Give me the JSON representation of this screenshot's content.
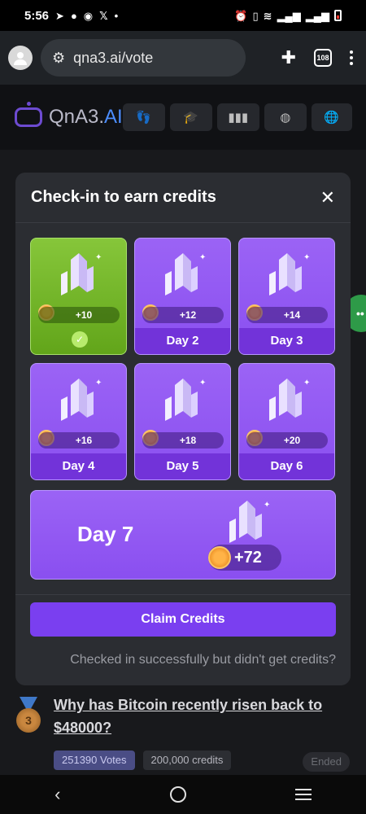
{
  "status": {
    "time": "5:56"
  },
  "browser": {
    "url": "qna3.ai/vote",
    "tab_count": "108"
  },
  "site": {
    "logo_text": "QnA3.",
    "logo_suffix": "AI"
  },
  "modal": {
    "title": "Check-in to earn credits",
    "cards": [
      {
        "amount": "+10",
        "day": "",
        "state": "done"
      },
      {
        "amount": "+12",
        "day": "Day 2",
        "state": "pending"
      },
      {
        "amount": "+14",
        "day": "Day 3",
        "state": "pending"
      },
      {
        "amount": "+16",
        "day": "Day 4",
        "state": "pending"
      },
      {
        "amount": "+18",
        "day": "Day 5",
        "state": "pending"
      },
      {
        "amount": "+20",
        "day": "Day 6",
        "state": "pending"
      }
    ],
    "day7": {
      "day": "Day 7",
      "amount": "+72"
    },
    "claim_label": "Claim Credits",
    "note": "Checked in successfully but didn't get credits?"
  },
  "question": {
    "title": "Why has Bitcoin recently risen back to $48000?",
    "rank": "3",
    "votes": "251390 Votes",
    "credits": "200,000 credits",
    "status": "Ended"
  }
}
